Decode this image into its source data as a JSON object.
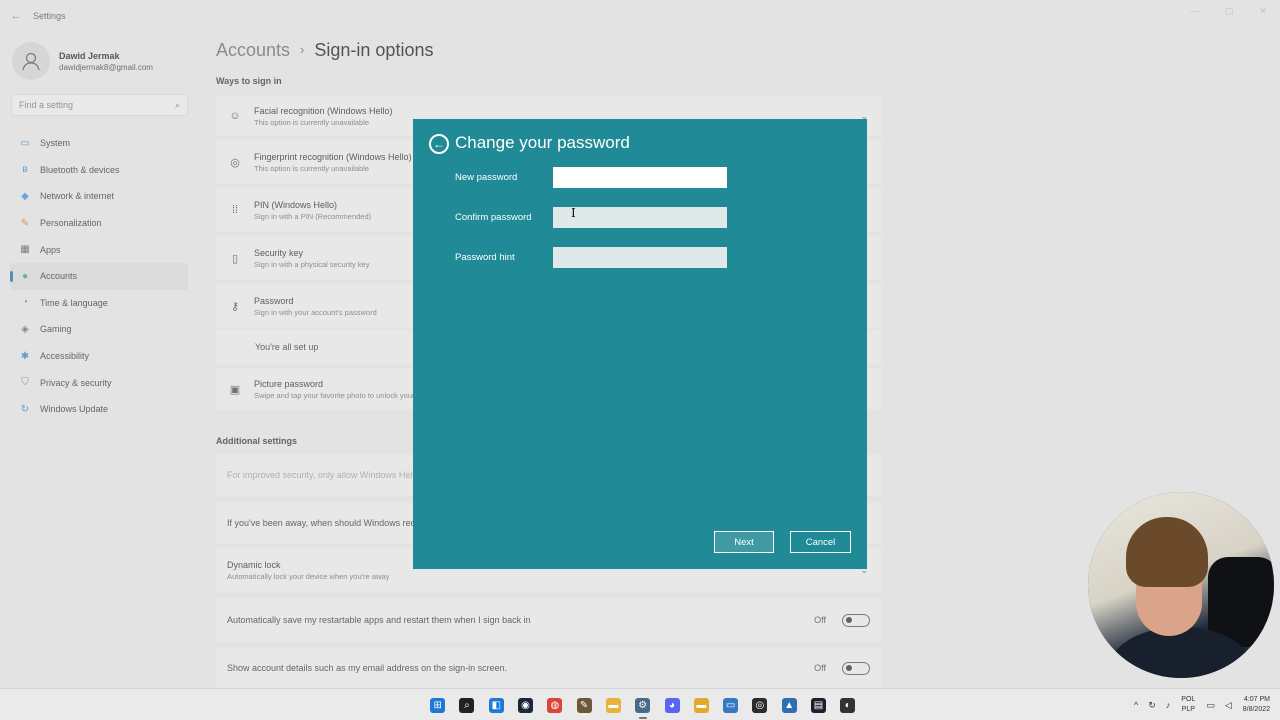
{
  "window": {
    "title": "Settings",
    "back_glyph": "←",
    "controls": [
      "—",
      "▢",
      "✕"
    ]
  },
  "profile": {
    "name": "Dawid Jermak",
    "email": "dawidjermak8@gmail.com"
  },
  "search": {
    "placeholder": "Find a setting"
  },
  "nav": {
    "items": [
      {
        "label": "System",
        "icon": "monitor-icon",
        "glyph": "▭",
        "color": "#2f7fc4"
      },
      {
        "label": "Bluetooth & devices",
        "icon": "bluetooth-icon",
        "glyph": "ʙ",
        "color": "#2f7fc4"
      },
      {
        "label": "Network & internet",
        "icon": "wifi-icon",
        "glyph": "◆",
        "color": "#3a8ed8"
      },
      {
        "label": "Personalization",
        "icon": "brush-icon",
        "glyph": "✎",
        "color": "#c27a2c"
      },
      {
        "label": "Apps",
        "icon": "apps-icon",
        "glyph": "▦",
        "color": "#555555"
      },
      {
        "label": "Accounts",
        "icon": "person-icon",
        "glyph": "●",
        "color": "#2aa58a"
      },
      {
        "label": "Time & language",
        "icon": "globe-clock-icon",
        "glyph": "◔",
        "color": "#2f7fc4"
      },
      {
        "label": "Gaming",
        "icon": "gamepad-icon",
        "glyph": "◈",
        "color": "#666666"
      },
      {
        "label": "Accessibility",
        "icon": "accessibility-icon",
        "glyph": "✱",
        "color": "#2f7fc4"
      },
      {
        "label": "Privacy & security",
        "icon": "shield-icon",
        "glyph": "⛉",
        "color": "#777777"
      },
      {
        "label": "Windows Update",
        "icon": "update-icon",
        "glyph": "↻",
        "color": "#2f7fc4"
      }
    ],
    "active_index": 5
  },
  "page": {
    "crumb_parent": "Accounts",
    "crumb_sep": "›",
    "title": "Sign-in options",
    "ways_label": "Ways to sign in",
    "additional_label": "Additional settings"
  },
  "ways": [
    {
      "title": "Facial recognition (Windows Hello)",
      "subtitle": "This option is currently unavailable",
      "glyph": "☺",
      "icon": "face-icon"
    },
    {
      "title": "Fingerprint recognition (Windows Hello)",
      "subtitle": "This option is currently unavailable",
      "glyph": "◎",
      "icon": "fingerprint-icon"
    },
    {
      "title": "PIN (Windows Hello)",
      "subtitle": "Sign in with a PIN (Recommended)",
      "glyph": "⁞⁞",
      "icon": "pin-icon"
    },
    {
      "title": "Security key",
      "subtitle": "Sign in with a physical security key",
      "glyph": "▯",
      "icon": "key-icon"
    },
    {
      "title": "Password",
      "subtitle": "Sign in with your account's password",
      "glyph": "⚷",
      "icon": "password-key-icon"
    },
    {
      "title": "Picture password",
      "subtitle": "Swipe and tap your favorite photo to unlock your device",
      "glyph": "▣",
      "icon": "picture-icon"
    }
  ],
  "password_status": "You're all set up",
  "additional": {
    "security_note": "For improved security, only allow Windows Hello sign-in for Microsoft accounts on this device",
    "away_prompt": "If you've been away, when should Windows require you to sign in again?",
    "dynamic_lock_title": "Dynamic lock",
    "dynamic_lock_subtitle": "Automatically lock your device when you're away",
    "restart_apps": "Automatically save my restartable apps and restart them when I sign back in",
    "restart_apps_state": "Off",
    "show_details": "Show account details such as my email address on the sign-in screen.",
    "show_details_state": "Off"
  },
  "dialog": {
    "back_glyph": "←",
    "title": "Change your password",
    "new_password_label": "New password",
    "new_password_value": "",
    "confirm_password_label": "Confirm password",
    "confirm_password_value": "",
    "hint_label": "Password hint",
    "hint_value": "",
    "next_label": "Next",
    "cancel_label": "Cancel",
    "accent_color": "#208a96"
  },
  "taskbar": {
    "icons": [
      {
        "name": "start-icon",
        "glyph": "⊞",
        "color": "#1e78d7"
      },
      {
        "name": "search-icon",
        "glyph": "⌕",
        "color": "#222222"
      },
      {
        "name": "task-view-icon",
        "glyph": "◧",
        "color": "#1e78d7"
      },
      {
        "name": "steam-icon",
        "glyph": "◉",
        "color": "#1b2838"
      },
      {
        "name": "chrome-icon",
        "glyph": "◍",
        "color": "#db4437"
      },
      {
        "name": "paint-icon",
        "glyph": "✎",
        "color": "#6b5a3a"
      },
      {
        "name": "file-explorer-icon",
        "glyph": "▬",
        "color": "#e8b33a"
      },
      {
        "name": "settings-gear-icon",
        "glyph": "⚙",
        "color": "#4a6a8a"
      },
      {
        "name": "discord-icon",
        "glyph": "◕",
        "color": "#5865f2"
      },
      {
        "name": "folder-icon",
        "glyph": "▬",
        "color": "#e3a92b"
      },
      {
        "name": "remote-desktop-icon",
        "glyph": "▭",
        "color": "#3478c6"
      },
      {
        "name": "obs-icon",
        "glyph": "◎",
        "color": "#2b2b2b"
      },
      {
        "name": "photos-icon",
        "glyph": "▲",
        "color": "#2d6fb0"
      },
      {
        "name": "app-icon",
        "glyph": "▤",
        "color": "#1e1e2e"
      },
      {
        "name": "notification-app-icon",
        "glyph": "◐",
        "color": "#333333"
      }
    ],
    "tray": {
      "chevron": "^",
      "language_top": "POL",
      "language_bottom": "PLP",
      "time": "4:07 PM",
      "date": "8/8/2022"
    }
  }
}
